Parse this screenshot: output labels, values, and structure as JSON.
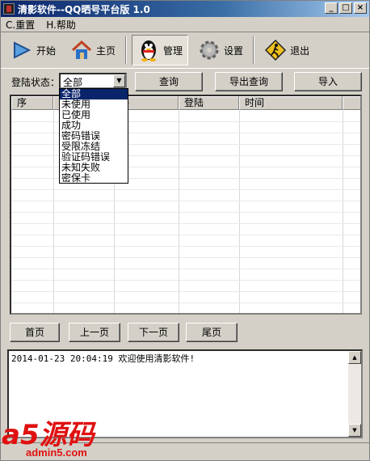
{
  "window": {
    "title": "清影软件--QQ晒号平台版 1.0",
    "controls": {
      "minimize": "_",
      "maximize": "□",
      "close": "×"
    }
  },
  "menu": [
    {
      "label": "C.重置"
    },
    {
      "label": "H.帮助"
    }
  ],
  "toolbar": {
    "items": [
      {
        "label": "开始",
        "icon": "play-arrow-icon"
      },
      {
        "label": "主页",
        "icon": "home-icon"
      },
      {
        "label": "管理",
        "icon": "qq-penguin-icon",
        "active": true
      },
      {
        "label": "设置",
        "icon": "gear-icon"
      },
      {
        "label": "退出",
        "icon": "exit-sign-icon"
      }
    ]
  },
  "filter": {
    "label": "登陆状态：",
    "selected": "全部",
    "options": [
      "全部",
      "未使用",
      "已使用",
      "成功",
      "密码错误",
      "受限冻结",
      "验证码错误",
      "未知失败",
      "密保卡"
    ]
  },
  "actions": {
    "query": "查询",
    "export": "导出查询",
    "import": "导入"
  },
  "table": {
    "columns": [
      "序",
      "",
      "码",
      "登陆",
      "时间"
    ]
  },
  "pagination": {
    "first": "首页",
    "prev": "上一页",
    "next": "下一页",
    "last": "尾页"
  },
  "log": {
    "line": "2014-01-23 20:04:19 欢迎使用清影软件!"
  },
  "watermark": {
    "top": "a5源码",
    "bottom": "admin5.com",
    "color": "#e01010"
  },
  "colors": {
    "title_start": "#0a246a",
    "title_end": "#a6caf0",
    "selection": "#0a246a"
  }
}
